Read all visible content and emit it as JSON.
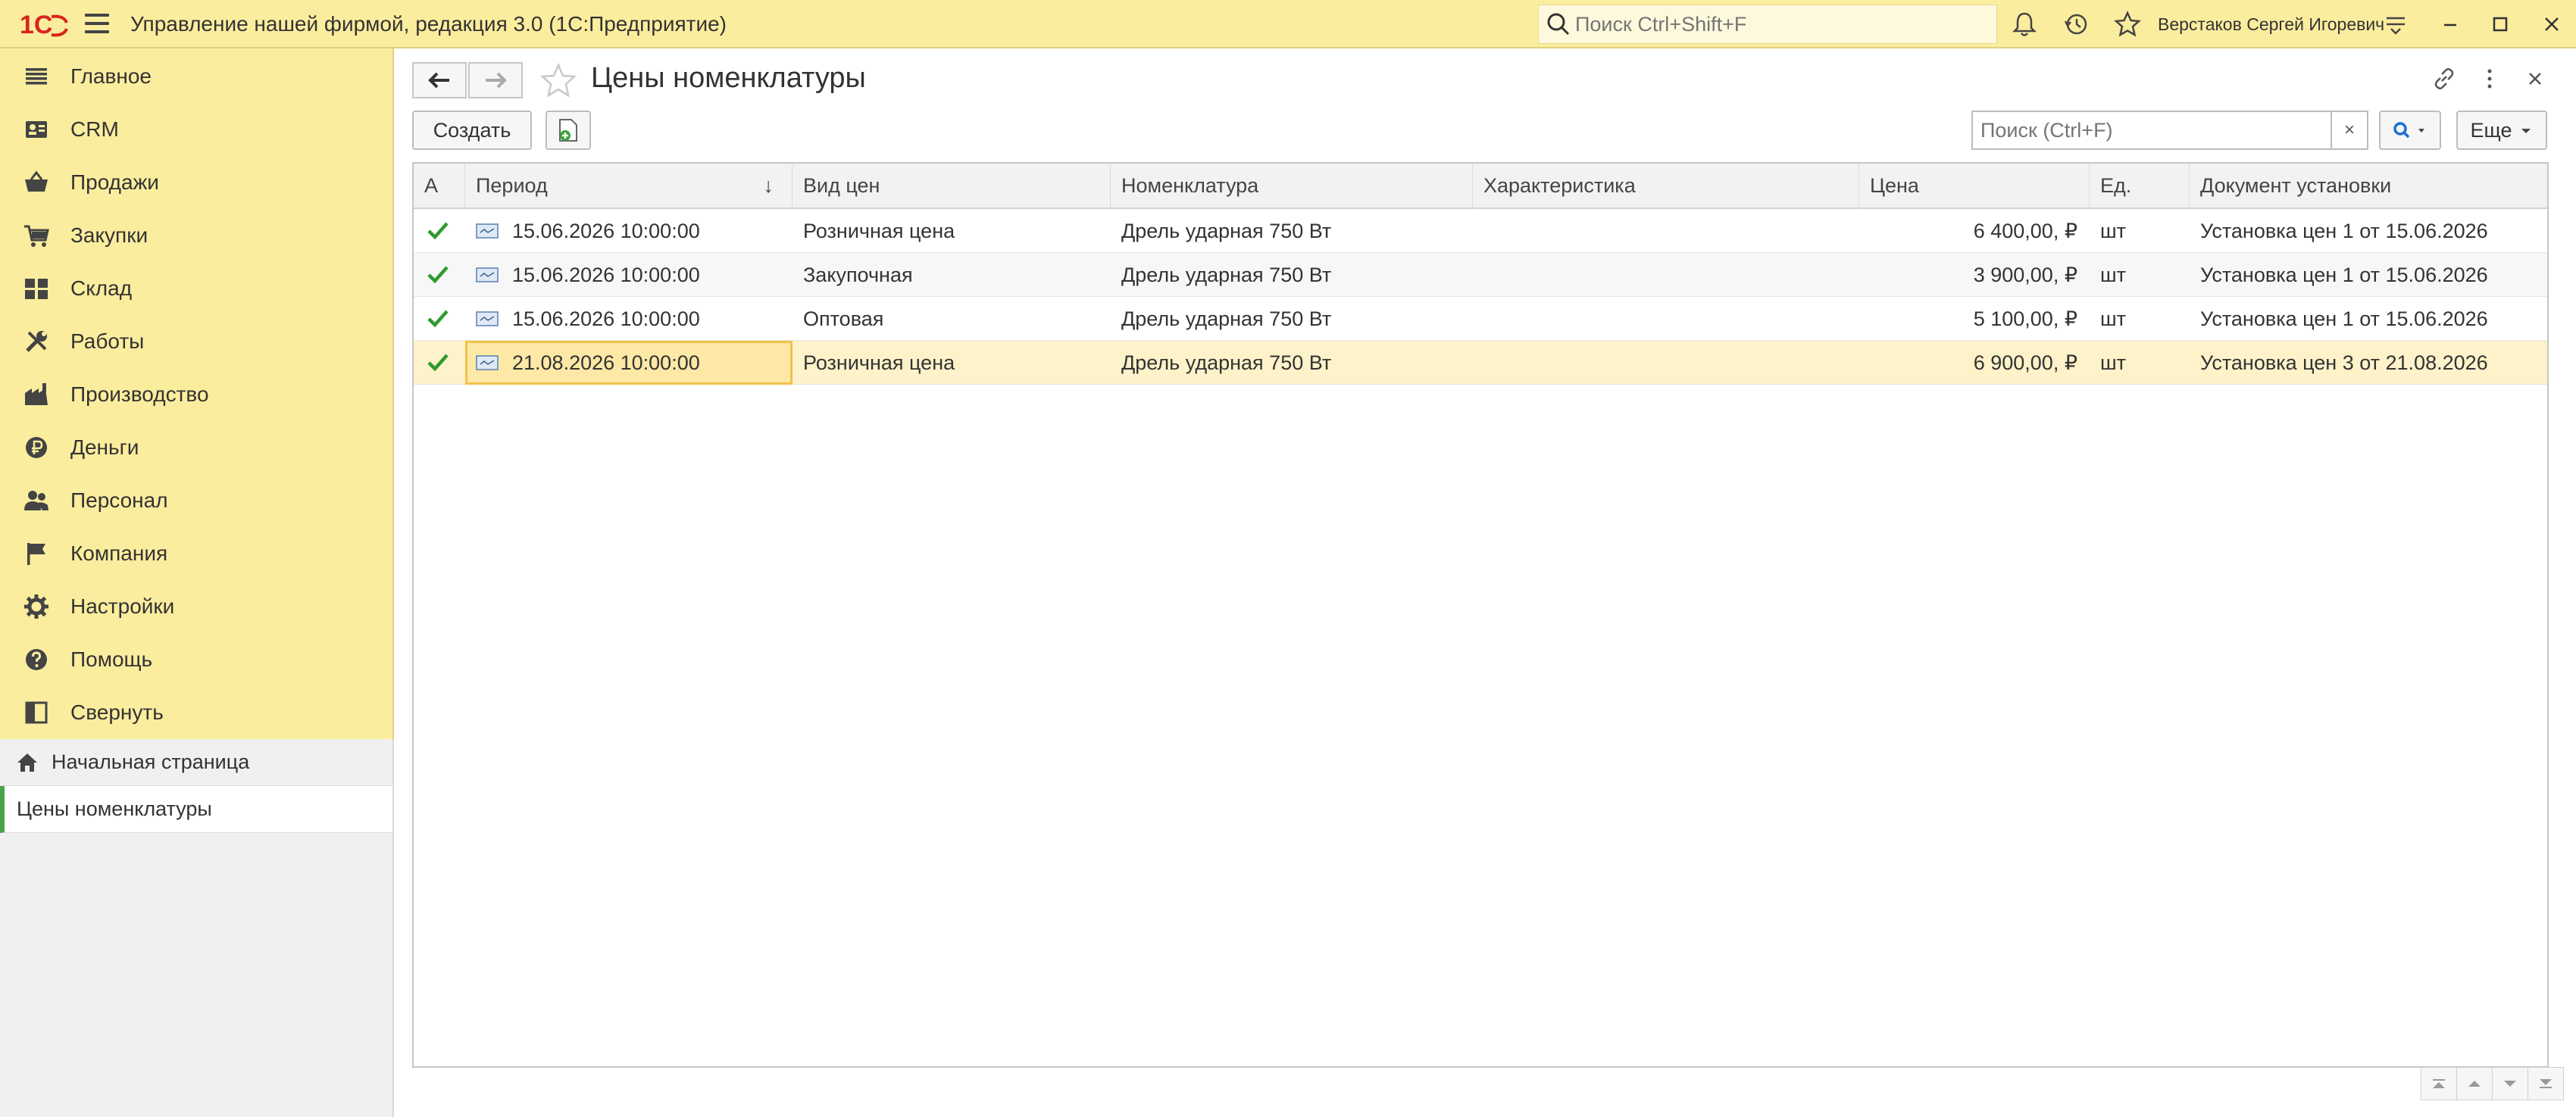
{
  "app": {
    "title": "Управление нашей фирмой, редакция 3.0  (1С:Предприятие)",
    "search_placeholder": "Поиск Ctrl+Shift+F",
    "user_name": "Верстаков Сергей Игоревич"
  },
  "sidebar": {
    "items": [
      {
        "label": "Главное",
        "icon": "list-icon"
      },
      {
        "label": "CRM",
        "icon": "contacts-icon"
      },
      {
        "label": "Продажи",
        "icon": "basket-icon"
      },
      {
        "label": "Закупки",
        "icon": "cart-icon"
      },
      {
        "label": "Склад",
        "icon": "warehouse-icon"
      },
      {
        "label": "Работы",
        "icon": "tools-icon"
      },
      {
        "label": "Производство",
        "icon": "factory-icon"
      },
      {
        "label": "Деньги",
        "icon": "ruble-icon"
      },
      {
        "label": "Персонал",
        "icon": "people-icon"
      },
      {
        "label": "Компания",
        "icon": "flag-icon"
      },
      {
        "label": "Настройки",
        "icon": "gear-icon"
      },
      {
        "label": "Помощь",
        "icon": "help-icon"
      },
      {
        "label": "Свернуть",
        "icon": "collapse-icon"
      }
    ],
    "open_windows": [
      {
        "label": "Начальная страница",
        "icon": "home-icon"
      },
      {
        "label": "Цены номенклатуры"
      }
    ]
  },
  "form": {
    "title": "Цены номенклатуры",
    "create_label": "Создать",
    "search_placeholder": "Поиск (Ctrl+F)",
    "clear_label": "×",
    "more_label": "Еще",
    "columns": [
      "А",
      "Период",
      "Вид цен",
      "Номенклатура",
      "Характеристика",
      "Цена",
      "Ед.",
      "Документ установки"
    ],
    "sort_indicator": "↓",
    "rows": [
      {
        "period": "15.06.2026 10:00:00",
        "price_type": "Розничная цена",
        "item": "Дрель ударная 750 Вт",
        "characteristic": "",
        "price": "6 400,00, ₽",
        "unit": "шт",
        "document": "Установка цен 1 от 15.06.2026"
      },
      {
        "period": "15.06.2026 10:00:00",
        "price_type": "Закупочная",
        "item": "Дрель ударная 750 Вт",
        "characteristic": "",
        "price": "3 900,00, ₽",
        "unit": "шт",
        "document": "Установка цен 1 от 15.06.2026"
      },
      {
        "period": "15.06.2026 10:00:00",
        "price_type": "Оптовая",
        "item": "Дрель ударная 750 Вт",
        "characteristic": "",
        "price": "5 100,00, ₽",
        "unit": "шт",
        "document": "Установка цен 1 от 15.06.2026"
      },
      {
        "period": "21.08.2026 10:00:00",
        "price_type": "Розничная цена",
        "item": "Дрель ударная 750 Вт",
        "characteristic": "",
        "price": "6 900,00, ₽",
        "unit": "шт",
        "document": "Установка цен 3 от 21.08.2026"
      }
    ]
  },
  "colors": {
    "accent_yellow": "#fbed9e",
    "check_green": "#2e9a2e",
    "logo_red": "#d7261e",
    "selected_row": "#fdf2c9",
    "focus_border": "#f3c24a"
  }
}
